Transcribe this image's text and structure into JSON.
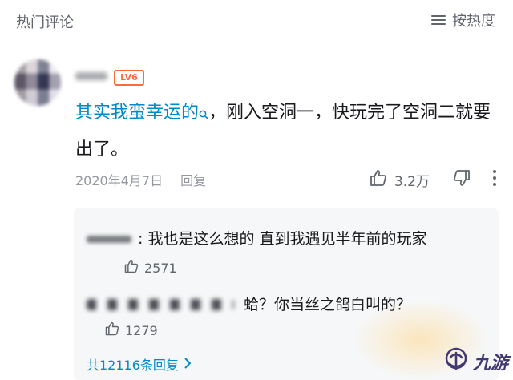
{
  "header": {
    "title": "热门评论",
    "sort_label": "按热度",
    "sort_icon": "sort-lines-icon"
  },
  "comment": {
    "level": "LV6",
    "text_link": "其实我蛮幸运的",
    "text_rest": "，刚入空洞一，快玩完了空洞二就要出了。",
    "date": "2020年4月7日",
    "reply_label": "回复",
    "likes": "3.2万",
    "colors": {
      "link": "#008ac5",
      "level": "#ff6a3d"
    }
  },
  "replies": {
    "items": [
      {
        "text": "我也是这么想的   直到我遇见半年前的玩家",
        "likes": "2571"
      },
      {
        "text": "蛤？你当丝之鸽白叫的？",
        "likes": "1279"
      }
    ],
    "more_label": "共12116条回复"
  },
  "watermark": {
    "text": "九游"
  }
}
